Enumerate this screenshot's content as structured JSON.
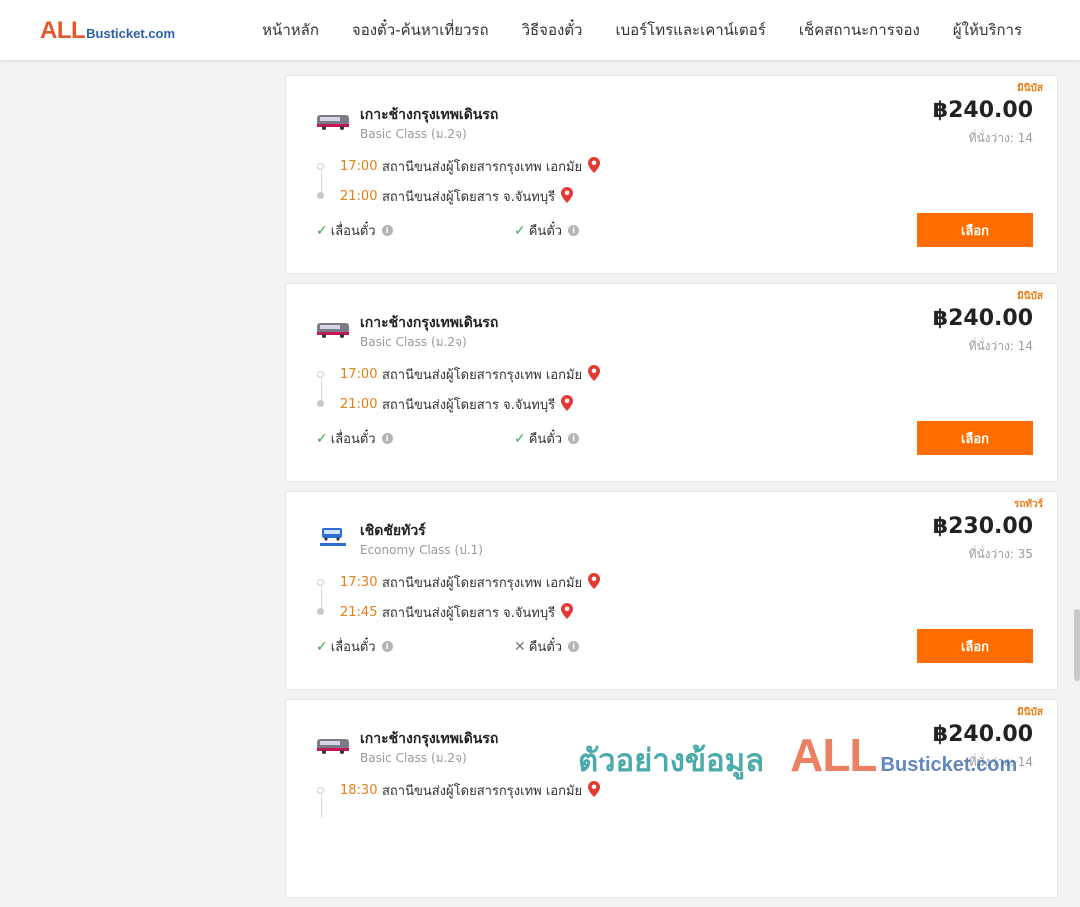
{
  "header": {
    "logo_main": "ALL",
    "logo_sub": "Busticket.com",
    "nav": [
      "หน้าหลัก",
      "จองตั๋ว-ค้นหาเที่ยวรถ",
      "วิธีจองตั๋ว",
      "เบอร์โทรและเคาน์เตอร์",
      "เช็คสถานะการจอง",
      "ผู้ให้บริการ"
    ]
  },
  "cards": [
    {
      "badge": "มินิบัส",
      "operator": "เกาะช้างกรุงเทพเดินรถ",
      "class": "Basic Class (ม.2จ)",
      "price": "฿240.00",
      "seats": "ที่นั่งว่าง: 14",
      "depart_time": "17:00",
      "depart_station": "สถานีขนส่งผู้โดยสารกรุงเทพ เอกมัย",
      "arrive_time": "21:00",
      "arrive_station": "สถานีขนส่งผู้โดยสาร จ.จันทบุรี",
      "option1": "เลื่อนตั๋ว",
      "option2": "คืนตั๋ว",
      "refund_available": true,
      "button": "เลือก",
      "logo_icon": "minibus-logo-icon"
    },
    {
      "badge": "มินิบัส",
      "operator": "เกาะช้างกรุงเทพเดินรถ",
      "class": "Basic Class (ม.2จ)",
      "price": "฿240.00",
      "seats": "ที่นั่งว่าง: 14",
      "depart_time": "17:00",
      "depart_station": "สถานีขนส่งผู้โดยสารกรุงเทพ เอกมัย",
      "arrive_time": "21:00",
      "arrive_station": "สถานีขนส่งผู้โดยสาร จ.จันทบุรี",
      "option1": "เลื่อนตั๋ว",
      "option2": "คืนตั๋ว",
      "refund_available": true,
      "button": "เลือก",
      "logo_icon": "minibus-logo-icon"
    },
    {
      "badge": "รถทัวร์",
      "operator": "เชิดชัยทัวร์",
      "class": "Economy Class (ป.1)",
      "price": "฿230.00",
      "seats": "ที่นั่งว่าง: 35",
      "depart_time": "17:30",
      "depart_station": "สถานีขนส่งผู้โดยสารกรุงเทพ เอกมัย",
      "arrive_time": "21:45",
      "arrive_station": "สถานีขนส่งผู้โดยสาร จ.จันทบุรี",
      "option1": "เลื่อนตั๋ว",
      "option2": "คืนตั๋ว",
      "refund_available": false,
      "button": "เลือก",
      "logo_icon": "cherdchai-logo-icon"
    },
    {
      "badge": "มินิบัส",
      "operator": "เกาะช้างกรุงเทพเดินรถ",
      "class": "Basic Class (ม.2จ)",
      "price": "฿240.00",
      "seats": "ที่นั่งว่าง: 14",
      "depart_time": "18:30",
      "depart_station": "สถานีขนส่งผู้โดยสารกรุงเทพ เอกมัย",
      "arrive_time": "",
      "arrive_station": "",
      "option1": "",
      "option2": "",
      "refund_available": true,
      "button": "",
      "logo_icon": "minibus-logo-icon"
    }
  ],
  "watermark": {
    "text": "ตัวอย่างข้อมูล",
    "logo_main": "ALL",
    "logo_sub": "Busticket.com"
  },
  "colors": {
    "accent": "#ff6d00",
    "time": "#e57e13",
    "check": "#3aa35a"
  }
}
